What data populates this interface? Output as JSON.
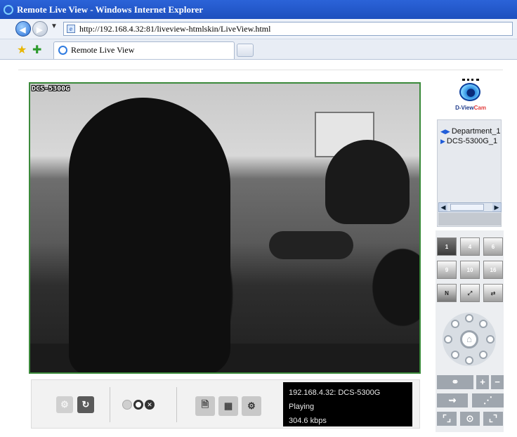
{
  "window": {
    "title": "Remote Live View - Windows Internet Explorer"
  },
  "address": {
    "url": "http://192.168.4.32:81/liveview-htmlskin/LiveView.html"
  },
  "tabs": [
    {
      "label": "Remote Live View"
    }
  ],
  "video": {
    "camera_label": "DCS-5300G"
  },
  "status": {
    "line1": "192.168.4.32: DCS-5300G",
    "line2": "Playing",
    "line3": "304.6 kbps"
  },
  "sidebar": {
    "logo_text_a": "D-View",
    "logo_text_b": "Cam",
    "tree": [
      {
        "label": "Department_1",
        "icon": "speaker-arrow-icon"
      },
      {
        "label": "DCS-5300G_1",
        "icon": "play-arrow-icon"
      }
    ],
    "layouts": [
      "1",
      "4",
      "6",
      "9",
      "10",
      "16"
    ],
    "layout_extra": [
      "N"
    ]
  },
  "colors": {
    "titlebar": "#2b63d8",
    "video_border": "#3b8a3b",
    "status_bg": "#000000"
  }
}
